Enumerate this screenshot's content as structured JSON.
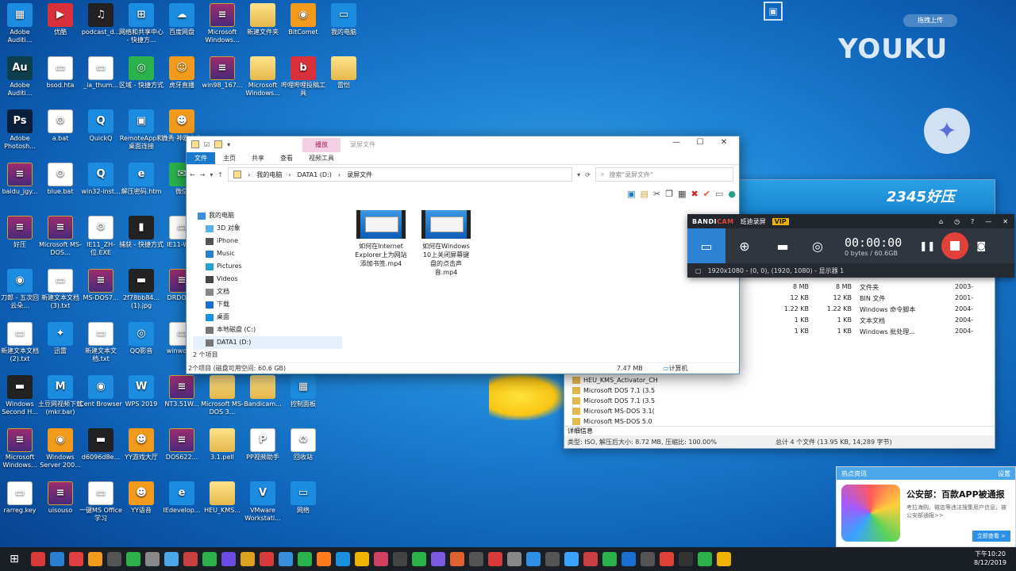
{
  "desktop_icons": [
    {
      "label": "Adobe Auditi...",
      "glyph": "▦",
      "style": "g-blue",
      "col": 0,
      "row": 0
    },
    {
      "label": "优酷",
      "glyph": "▶",
      "style": "g-red",
      "col": 1,
      "row": 0
    },
    {
      "label": "podcast_d...",
      "glyph": "♫",
      "style": "g-dark",
      "col": 2,
      "row": 0
    },
    {
      "label": "网络和共享中心 - 快捷方...",
      "glyph": "⊞",
      "style": "g-blue",
      "col": 3,
      "row": 0
    },
    {
      "label": "百度网盘",
      "glyph": "☁",
      "style": "g-blue",
      "col": 4,
      "row": 0
    },
    {
      "label": "Microsoft Windows...",
      "glyph": "≡",
      "style": "g-winrar",
      "col": 5,
      "row": 0
    },
    {
      "label": "新建文件夹",
      "glyph": "",
      "style": "g-folder",
      "col": 6,
      "row": 0
    },
    {
      "label": "BitComet",
      "glyph": "◉",
      "style": "g-orange",
      "col": 7,
      "row": 0
    },
    {
      "label": "我的电脑",
      "glyph": "▭",
      "style": "g-blue",
      "col": 8,
      "row": 0
    },
    {
      "label": "Adobe Auditi...",
      "glyph": "Au",
      "style": "g-au",
      "col": 0,
      "row": 1
    },
    {
      "label": "bsod.hta",
      "glyph": "▭",
      "style": "g-doc",
      "col": 1,
      "row": 1
    },
    {
      "label": "_ia_thum...",
      "glyph": "▭",
      "style": "g-doc",
      "col": 2,
      "row": 1
    },
    {
      "label": "区域 - 快捷方式",
      "glyph": "◎",
      "style": "g-green",
      "col": 3,
      "row": 1
    },
    {
      "label": "虎牙直播",
      "glyph": "☺",
      "style": "g-orange",
      "col": 4,
      "row": 1
    },
    {
      "label": "win98_167...",
      "glyph": "≡",
      "style": "g-winrar",
      "col": 5,
      "row": 1
    },
    {
      "label": "Microsoft Windows...",
      "glyph": "",
      "style": "g-folder",
      "col": 6,
      "row": 1
    },
    {
      "label": "哔哩哔哩投稿工具",
      "glyph": "b",
      "style": "g-red",
      "col": 7,
      "row": 1
    },
    {
      "label": "雷恺",
      "glyph": "",
      "style": "g-folder",
      "col": 8,
      "row": 1
    },
    {
      "label": "Adobe Photosh...",
      "glyph": "Ps",
      "style": "g-ps",
      "col": 0,
      "row": 2
    },
    {
      "label": "a.bat",
      "glyph": "⚙",
      "style": "g-doc",
      "col": 1,
      "row": 2
    },
    {
      "label": "QuickQ",
      "glyph": "Q",
      "style": "g-blue",
      "col": 2,
      "row": 2
    },
    {
      "label": "RemoteApp和桌面连接",
      "glyph": "▣",
      "style": "g-blue",
      "col": 3,
      "row": 2
    },
    {
      "label": "微秀·神器大全",
      "glyph": "☻",
      "style": "g-orange",
      "col": 4,
      "row": 2
    },
    {
      "label": "baidu_jgy...",
      "glyph": "≡",
      "style": "g-winrar",
      "col": 0,
      "row": 3
    },
    {
      "label": "blue.bat",
      "glyph": "⚙",
      "style": "g-doc",
      "col": 1,
      "row": 3
    },
    {
      "label": "win32-inst...",
      "glyph": "Q",
      "style": "g-blue",
      "col": 2,
      "row": 3
    },
    {
      "label": "解压密码.htm",
      "glyph": "e",
      "style": "g-blue",
      "col": 3,
      "row": 3
    },
    {
      "label": "微信",
      "glyph": "✉",
      "style": "g-green",
      "col": 4,
      "row": 3
    },
    {
      "label": "好压",
      "glyph": "≡",
      "style": "g-winrar",
      "col": 0,
      "row": 4
    },
    {
      "label": "Microsoft MS-DOS...",
      "glyph": "≡",
      "style": "g-winrar",
      "col": 1,
      "row": 4
    },
    {
      "label": "IE11_ZH-位.EXE",
      "glyph": "⚙",
      "style": "g-doc",
      "col": 2,
      "row": 4
    },
    {
      "label": "捕获 - 快捷方式",
      "glyph": "▮",
      "style": "g-dark",
      "col": 3,
      "row": 4
    },
    {
      "label": "IE11-Wi...",
      "glyph": "▭",
      "style": "g-doc",
      "col": 4,
      "row": 4
    },
    {
      "label": "刀郎 - 五次回 云朵...",
      "glyph": "◉",
      "style": "g-blue",
      "col": 0,
      "row": 5
    },
    {
      "label": "新建文本文档(3).txt",
      "glyph": "▭",
      "style": "g-doc",
      "col": 1,
      "row": 5
    },
    {
      "label": "MS-DOS7...",
      "glyph": "≡",
      "style": "g-winrar",
      "col": 2,
      "row": 5
    },
    {
      "label": "2f78bb84...(1).jpg",
      "glyph": "▬",
      "style": "g-dark",
      "col": 3,
      "row": 5
    },
    {
      "label": "DRDOS...",
      "glyph": "≡",
      "style": "g-winrar",
      "col": 4,
      "row": 5
    },
    {
      "label": "新建文本文档(2).txt",
      "glyph": "▭",
      "style": "g-doc",
      "col": 0,
      "row": 6
    },
    {
      "label": "迅雷",
      "glyph": "✦",
      "style": "g-blue",
      "col": 1,
      "row": 6
    },
    {
      "label": "新建文本文档.txt",
      "glyph": "▭",
      "style": "g-doc",
      "col": 2,
      "row": 6
    },
    {
      "label": "QQ影音",
      "glyph": "◎",
      "style": "g-blue",
      "col": 3,
      "row": 6
    },
    {
      "label": "winworl...",
      "glyph": "▭",
      "style": "g-doc",
      "col": 4,
      "row": 6
    },
    {
      "label": "Windows Second H...",
      "glyph": "▬",
      "style": "g-dark",
      "col": 0,
      "row": 7
    },
    {
      "label": "土豆网视频下载(mkr.bar)",
      "glyph": "M",
      "style": "g-blue",
      "col": 1,
      "row": 7
    },
    {
      "label": "Cent Browser",
      "glyph": "◉",
      "style": "g-blue",
      "col": 2,
      "row": 7
    },
    {
      "label": "WPS 2019",
      "glyph": "W",
      "style": "g-blue",
      "col": 3,
      "row": 7
    },
    {
      "label": "NT3.51W...",
      "glyph": "≡",
      "style": "g-winrar",
      "col": 4,
      "row": 7
    },
    {
      "label": "Microsoft MS-DOS 3...",
      "glyph": "",
      "style": "g-folder",
      "col": 5,
      "row": 7
    },
    {
      "label": "Bandicam...",
      "glyph": "",
      "style": "g-folder",
      "col": 6,
      "row": 7
    },
    {
      "label": "控制面板",
      "glyph": "▦",
      "style": "g-blue",
      "col": 7,
      "row": 7
    },
    {
      "label": "Microsoft Windows...",
      "glyph": "≡",
      "style": "g-winrar",
      "col": 0,
      "row": 8
    },
    {
      "label": "Windows Server 200...",
      "glyph": "◉",
      "style": "g-orange",
      "col": 1,
      "row": 8
    },
    {
      "label": "d6096d8e...",
      "glyph": "▬",
      "style": "g-dark",
      "col": 2,
      "row": 8
    },
    {
      "label": "YY游戏大厅",
      "glyph": "☻",
      "style": "g-orange",
      "col": 3,
      "row": 8
    },
    {
      "label": "DOS622...",
      "glyph": "≡",
      "style": "g-winrar",
      "col": 4,
      "row": 8
    },
    {
      "label": "3.1.pell",
      "glyph": "",
      "style": "g-folder",
      "col": 5,
      "row": 8
    },
    {
      "label": "PP视频助手",
      "glyph": "P",
      "style": "g-doc",
      "col": 6,
      "row": 8
    },
    {
      "label": "回收站",
      "glyph": "♻",
      "style": "g-doc",
      "col": 7,
      "row": 8
    },
    {
      "label": "rarreg.key",
      "glyph": "▭",
      "style": "g-doc",
      "col": 0,
      "row": 9
    },
    {
      "label": "uisouso",
      "glyph": "≡",
      "style": "g-winrar",
      "col": 1,
      "row": 9
    },
    {
      "label": "一键MS Office学习",
      "glyph": "▭",
      "style": "g-doc",
      "col": 2,
      "row": 9
    },
    {
      "label": "YY语音",
      "glyph": "☻",
      "style": "g-orange",
      "col": 3,
      "row": 9
    },
    {
      "label": "IEdevelop...",
      "glyph": "e",
      "style": "g-blue",
      "col": 4,
      "row": 9
    },
    {
      "label": "HEU_KMS...",
      "glyph": "",
      "style": "g-folder",
      "col": 5,
      "row": 9
    },
    {
      "label": "VMware Workstati...",
      "glyph": "V",
      "style": "g-blue",
      "col": 6,
      "row": 9
    },
    {
      "label": "网络",
      "glyph": "▭",
      "style": "g-blue",
      "col": 7,
      "row": 9
    }
  ],
  "explorer": {
    "play_tab": "播放",
    "window_title": "录屏文件",
    "tabs": [
      "文件",
      "主页",
      "共享",
      "查看",
      "视频工具"
    ],
    "breadcrumb": [
      "我的电脑",
      "DATA1 (D:)",
      "录屏文件"
    ],
    "search_placeholder": "搜索\"录屏文件\"",
    "nav": [
      {
        "label": "我的电脑",
        "icon": "computer-icon",
        "indent": 0
      },
      {
        "label": "3D 对象",
        "icon": "cube-icon",
        "indent": 1
      },
      {
        "label": "iPhone",
        "icon": "phone-icon",
        "indent": 1
      },
      {
        "label": "Music",
        "icon": "music-icon",
        "indent": 1
      },
      {
        "label": "Pictures",
        "icon": "pictures-icon",
        "indent": 1
      },
      {
        "label": "Videos",
        "icon": "videos-icon",
        "indent": 1
      },
      {
        "label": "文档",
        "icon": "documents-icon",
        "indent": 1
      },
      {
        "label": "下载",
        "icon": "download-icon",
        "indent": 1
      },
      {
        "label": "桌面",
        "icon": "desktop-icon",
        "indent": 1
      },
      {
        "label": "本地磁盘 (C:)",
        "icon": "drive-icon",
        "indent": 1
      },
      {
        "label": "DATA1 (D:)",
        "icon": "drive-icon",
        "indent": 1
      }
    ],
    "files": [
      {
        "name": "如何在Internet Explorer上为网站添加书签.mp4"
      },
      {
        "name": "如何在Windows 10上关闭屏幕键盘的点击声音.mp4"
      }
    ],
    "item_count": "2 个项目",
    "status_left": "2个项目 (磁盘可用空间: 60.6 GB)",
    "status_size": "7.47 MB",
    "status_computer": "计算机"
  },
  "winrar": {
    "brand": "2345好压",
    "rows": [
      {
        "size": "8 MB",
        "packed": "8 MB",
        "type": "文件夹",
        "date": "2003-"
      },
      {
        "size": "12 KB",
        "packed": "12 KB",
        "type": "BIN 文件",
        "date": "2001-"
      },
      {
        "size": "1.22 KB",
        "packed": "1.22 KB",
        "type": "Windows 命令脚本",
        "date": "2004-"
      },
      {
        "size": "1 KB",
        "packed": "1 KB",
        "type": "文本文档",
        "date": "2004-"
      },
      {
        "size": "1 KB",
        "packed": "1 KB",
        "type": "Windows 批处理...",
        "date": "2004-"
      }
    ],
    "folders": [
      "HEU_KMS_Activator_CH",
      "Microsoft DOS 7.1 (3.5",
      "Microsoft DOS 7.1 (3.5",
      "Microsoft MS-DOS 3.1(",
      "Microsoft MS-DOS 5.0"
    ],
    "detail_label": "详细信息",
    "status_left": "类型: ISO, 解压后大小: 8.72 MB, 压缩比: 100.00%",
    "status_right": "总计 4 个文件 (13.95 KB, 14,289 字节)"
  },
  "bandicam": {
    "logo_a": "BANDI",
    "logo_b": "CAM",
    "tag": "班迪录屏",
    "vip": "VIP",
    "timer": "00:00:00",
    "size": "0 bytes / 60.6GB",
    "resolution": "1920x1080 - (0, 0), (1920, 1080) - 显示器 1"
  },
  "youku": {
    "logo": "YOUKU",
    "upload": "拖拽上传"
  },
  "news": {
    "header": "热点资讯",
    "settings": "设置",
    "title": "公安部：百款APP被通报",
    "body": "考拉海购、微店等违法搜集用户信息，被公安部通报>>",
    "button": "立即查看 >"
  },
  "taskbar": {
    "time": "下午10:20",
    "date": "8/12/2019"
  },
  "colors": {
    "accent": "#1979ca",
    "record": "#e2413a"
  }
}
